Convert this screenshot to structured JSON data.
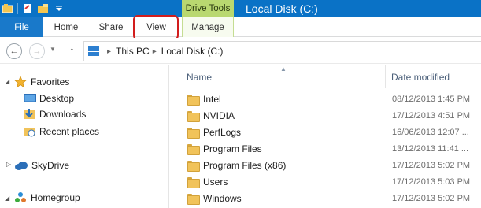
{
  "window": {
    "title": "Local Disk (C:)",
    "context_tab_group": "Drive Tools",
    "colors": {
      "titlebar": "#0a72c6",
      "file_tab": "#1979ca",
      "drive_tools": "#b9d870",
      "highlight_box": "#d21d1d"
    }
  },
  "quick_access": {
    "icons": [
      "app-icon",
      "properties-icon",
      "new-folder-icon",
      "customize-dropdown-icon"
    ]
  },
  "ribbon": {
    "tabs": [
      {
        "label": "File"
      },
      {
        "label": "Home"
      },
      {
        "label": "Share"
      },
      {
        "label": "View"
      },
      {
        "label": "Manage"
      }
    ],
    "highlighted_tab": "View"
  },
  "address_bar": {
    "segments": [
      "This PC",
      "Local Disk (C:)"
    ]
  },
  "nav_pane": {
    "favorites": {
      "label": "Favorites",
      "items": [
        "Desktop",
        "Downloads",
        "Recent places"
      ]
    },
    "skydrive": {
      "label": "SkyDrive"
    },
    "homegroup": {
      "label": "Homegroup"
    }
  },
  "file_list": {
    "columns": {
      "name": "Name",
      "date": "Date modified"
    },
    "rows": [
      {
        "name": "Intel",
        "date": "08/12/2013 1:45 PM"
      },
      {
        "name": "NVIDIA",
        "date": "17/12/2013 4:51 PM"
      },
      {
        "name": "PerfLogs",
        "date": "16/06/2013 12:07 ..."
      },
      {
        "name": "Program Files",
        "date": "13/12/2013 11:41 ..."
      },
      {
        "name": "Program Files (x86)",
        "date": "17/12/2013 5:02 PM"
      },
      {
        "name": "Users",
        "date": "17/12/2013 5:03 PM"
      },
      {
        "name": "Windows",
        "date": "17/12/2013 5:02 PM"
      }
    ]
  }
}
